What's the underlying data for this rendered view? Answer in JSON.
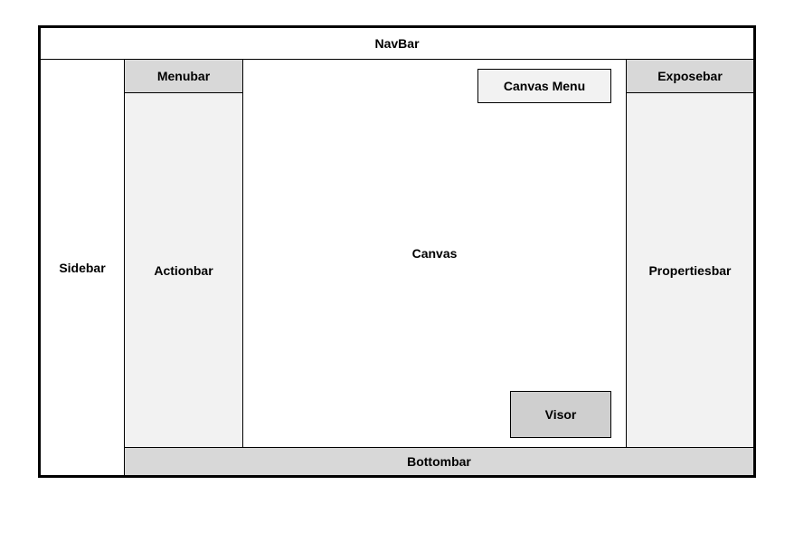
{
  "layout": {
    "navbar": {
      "label": "NavBar"
    },
    "sidebar": {
      "label": "Sidebar"
    },
    "menubar": {
      "label": "Menubar"
    },
    "actionbar": {
      "label": "Actionbar"
    },
    "canvas": {
      "label": "Canvas"
    },
    "canvas_menu": {
      "label": "Canvas Menu"
    },
    "visor": {
      "label": "Visor"
    },
    "exposebar": {
      "label": "Exposebar"
    },
    "propertiesbar": {
      "label": "Propertiesbar"
    },
    "bottombar": {
      "label": "Bottombar"
    }
  },
  "colors": {
    "chrome_dark": "#d8d8d8",
    "chrome_mid": "#cfcfcf",
    "chrome_light": "#f2f2f2",
    "border": "#000000",
    "background": "#ffffff"
  }
}
